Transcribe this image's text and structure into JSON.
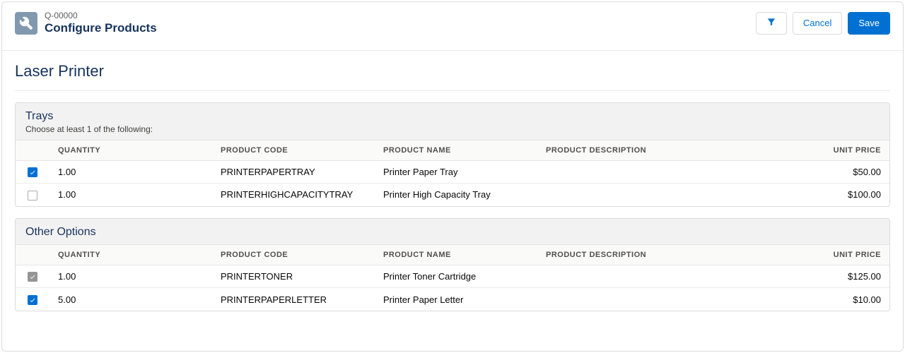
{
  "header": {
    "subtitle": "Q-00000",
    "title": "Configure Products",
    "cancel_label": "Cancel",
    "save_label": "Save"
  },
  "product_title": "Laser Printer",
  "columns": {
    "quantity": "QUANTITY",
    "product_code": "PRODUCT CODE",
    "product_name": "PRODUCT NAME",
    "product_description": "PRODUCT DESCRIPTION",
    "unit_price": "UNIT PRICE"
  },
  "groups": [
    {
      "title": "Trays",
      "subtitle": "Choose at least 1 of the following:",
      "rows": [
        {
          "checked": true,
          "disabled": false,
          "quantity": "1.00",
          "code": "PRINTERPAPERTRAY",
          "name": "Printer Paper Tray",
          "description": "",
          "price": "$50.00"
        },
        {
          "checked": false,
          "disabled": false,
          "quantity": "1.00",
          "code": "PRINTERHIGHCAPACITYTRAY",
          "name": "Printer High Capacity Tray",
          "description": "",
          "price": "$100.00"
        }
      ]
    },
    {
      "title": "Other Options",
      "subtitle": "",
      "rows": [
        {
          "checked": true,
          "disabled": true,
          "quantity": "1.00",
          "code": "PRINTERTONER",
          "name": "Printer Toner Cartridge",
          "description": "",
          "price": "$125.00"
        },
        {
          "checked": true,
          "disabled": false,
          "quantity": "5.00",
          "code": "PRINTERPAPERLETTER",
          "name": "Printer Paper Letter",
          "description": "",
          "price": "$10.00"
        }
      ]
    }
  ]
}
